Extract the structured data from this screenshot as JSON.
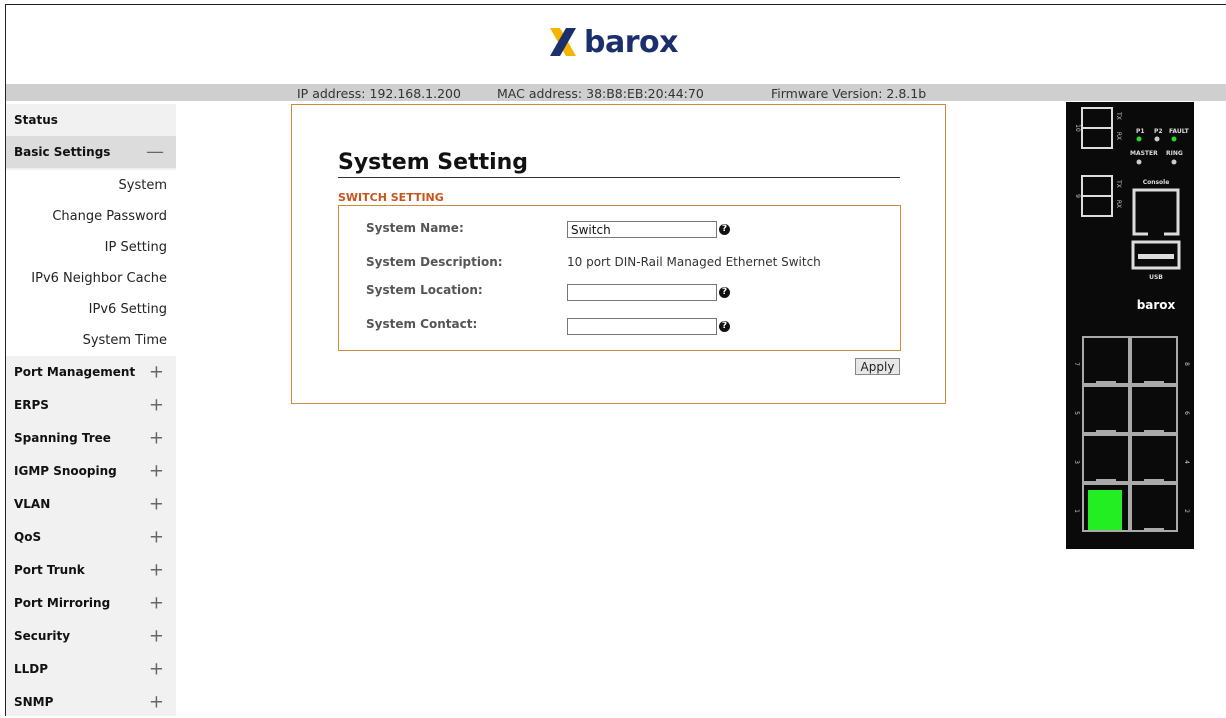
{
  "brand": {
    "name": "barox",
    "accent": "#1b2f6b",
    "logo_accent": "#f5b400"
  },
  "header": {
    "ip_address": "IP address: 192.168.1.200",
    "mac_address": "MAC address: 38:B8:EB:20:44:70",
    "firmware": "Firmware Version: 2.8.1b"
  },
  "sidebar": {
    "status": "Status",
    "basic_settings": {
      "label": "Basic Settings",
      "toggle": "—"
    },
    "sub_items": [
      "System",
      "Change Password",
      "IP Setting",
      "IPv6 Neighbor Cache",
      "IPv6 Setting",
      "System Time"
    ],
    "groups": [
      {
        "label": "Port Management",
        "toggle": "+"
      },
      {
        "label": "ERPS",
        "toggle": "+"
      },
      {
        "label": "Spanning Tree",
        "toggle": "+"
      },
      {
        "label": "IGMP Snooping",
        "toggle": "+"
      },
      {
        "label": "VLAN",
        "toggle": "+"
      },
      {
        "label": "QoS",
        "toggle": "+"
      },
      {
        "label": "Port Trunk",
        "toggle": "+"
      },
      {
        "label": "Port Mirroring",
        "toggle": "+"
      },
      {
        "label": "Security",
        "toggle": "+"
      },
      {
        "label": "LLDP",
        "toggle": "+"
      },
      {
        "label": "SNMP",
        "toggle": "+"
      }
    ]
  },
  "main": {
    "title": "System Setting",
    "section": "SWITCH SETTING",
    "fields": {
      "name_label": "System Name:",
      "name_value": "Switch",
      "description_label": "System Description:",
      "description_value": "10 port DIN-Rail Managed Ethernet Switch",
      "location_label": "System Location:",
      "location_value": "",
      "contact_label": "System Contact:",
      "contact_value": ""
    },
    "help_glyph": "?",
    "apply_label": "Apply"
  },
  "device": {
    "leds": {
      "p1": "P1",
      "p2": "P2",
      "fault": "FAULT",
      "master": "MASTER",
      "ring": "RING"
    },
    "tx": "TX",
    "rx": "RX",
    "console": "Console",
    "usb": "USB",
    "brand": "barox",
    "sfp_ports": [
      "10",
      "9"
    ],
    "rj45_ports": [
      "7",
      "8",
      "5",
      "6",
      "3",
      "4",
      "1",
      "2"
    ],
    "active_port": "1",
    "active_color": "#22ee22"
  }
}
